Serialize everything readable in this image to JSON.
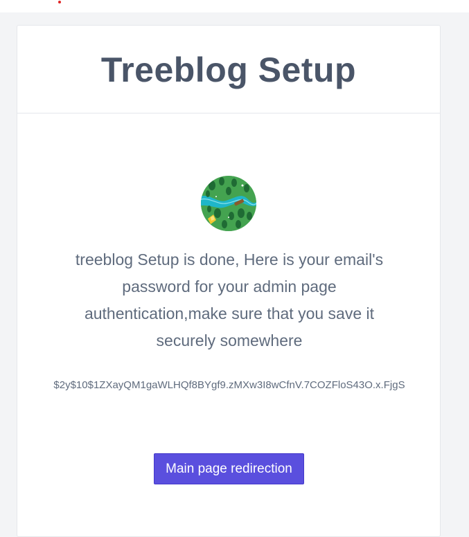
{
  "header": {
    "title": "Treeblog Setup"
  },
  "content": {
    "logo_icon": "forest-river-logo-icon",
    "message": "treeblog Setup is done, Here is your email's password for your admin page authentication,make sure that you save it securely somewhere",
    "password_hash": "$2y$10$1ZXayQM1gaWLHQf8BYgf9.zMXw3I8wCfnV.7COZFloS43O.x.FjgS",
    "redirect_button_label": "Main page redirection"
  },
  "colors": {
    "page_background": "#f3f4f6",
    "title_text": "#4a5568",
    "body_text": "#5f6b7d",
    "button_background": "#5a4fde",
    "button_text": "#ffffff"
  }
}
